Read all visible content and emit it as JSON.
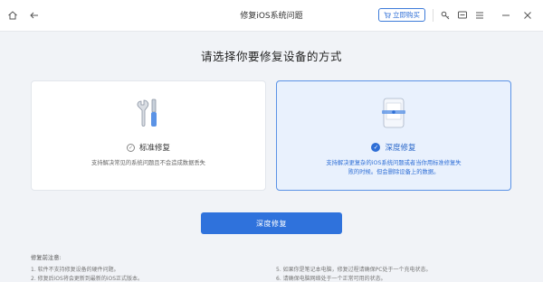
{
  "window": {
    "title": "修复iOS系统问题",
    "buy_label": "立即购买"
  },
  "headline": "请选择你要修复设备的方式",
  "cards": [
    {
      "title": "标准修复",
      "desc_line1": "支持解决常见的系统问题且不会造成数据丢失"
    },
    {
      "title": "深度修复",
      "desc_line1": "支持解决更复杂的iOS系统问题或者当你用标准修复失",
      "desc_line2": "败的时候。但会删除设备上的数据。"
    }
  ],
  "primary_button": "深度修复",
  "notes": {
    "title": "修复前注意:",
    "items": [
      "1. 软件不支持修复设备的硬件问题。",
      "2. 修复后iOS将会更新到最新的iOS正式版本。",
      "5. 如果你是笔记本电脑，修复过程请确保PC处于一个充电状态。",
      "6. 请确保电脑网络处于一个正常可用的状态。"
    ]
  },
  "colors": {
    "accent": "#2f72dc",
    "selected_card_bg": "#e9f1fd",
    "selected_card_border": "#5b93e6",
    "page_bg": "#f1f3f7"
  }
}
